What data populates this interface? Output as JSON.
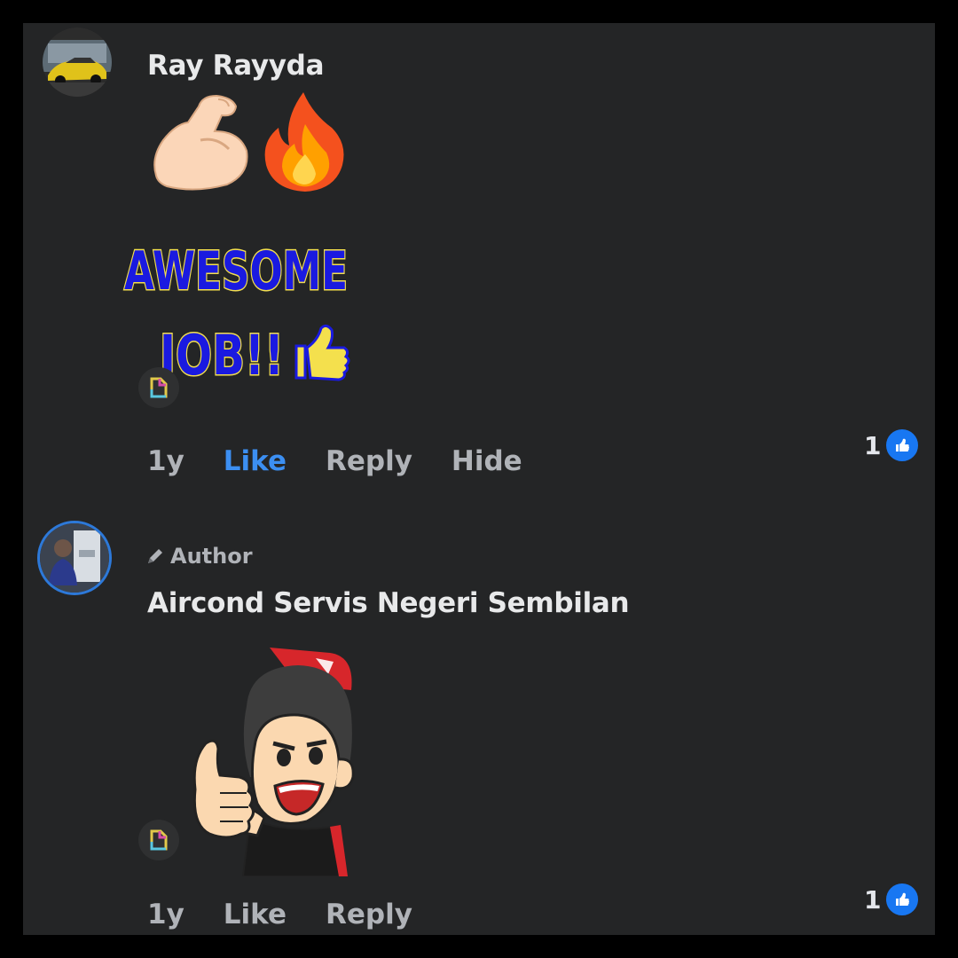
{
  "comments": [
    {
      "author_name": "Ray Rayyda",
      "timestamp": "1y",
      "actions": {
        "like": "Like",
        "reply": "Reply",
        "hide": "Hide"
      },
      "reaction_count": "1",
      "emojis": [
        "flexed-biceps-icon",
        "fire-icon"
      ],
      "sticker_text": [
        "AWESOME",
        "JOB!!"
      ],
      "like_active": true
    },
    {
      "author_badge": "Author",
      "author_name": "Aircond Servis Negeri Sembilan",
      "timestamp": "1y",
      "actions": {
        "like": "Like",
        "reply": "Reply"
      },
      "reaction_count": "1",
      "sticker": "thumbs-up-character-sticker",
      "like_active": false
    }
  ],
  "colors": {
    "background": "#242526",
    "frame": "#000000",
    "text_primary": "#e8e9ea",
    "text_secondary": "#b0b3b8",
    "like_active": "#3c8ff2",
    "reaction_blue": "#1877f2",
    "sticker_blue": "#1a1ae0",
    "sticker_yellow": "#f4e04d"
  }
}
